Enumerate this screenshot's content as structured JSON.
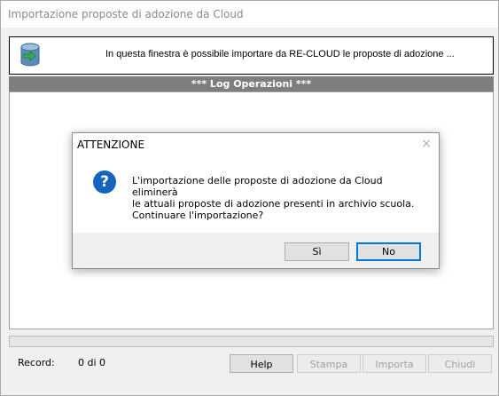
{
  "window": {
    "title": "Importazione proposte di adozione da Cloud"
  },
  "info": {
    "text": "In questa finestra è possibile importare da RE-CLOUD le proposte di adozione ...",
    "icon": "database-import-icon"
  },
  "log": {
    "header": "*** Log Operazioni ***"
  },
  "progress": {
    "value": 0
  },
  "record": {
    "label": "Record:",
    "value": "0 di 0"
  },
  "buttons": {
    "help": "Help",
    "stampa": "Stampa",
    "importa": "Importa",
    "chiudi": "Chiudi"
  },
  "dialog": {
    "title": "ATTENZIONE",
    "close": "×",
    "icon": "question-icon",
    "message_lines": [
      "L'importazione delle proposte di adozione da Cloud eliminerà",
      "le attuali proposte di adozione presenti in archivio scuola.",
      "Continuare l'importazione?"
    ],
    "yes": "Sì",
    "no": "No"
  },
  "colors": {
    "log_header_bg": "#7e7e7e",
    "dialog_focus": "#0078d7",
    "question_icon": "#1565c0"
  }
}
